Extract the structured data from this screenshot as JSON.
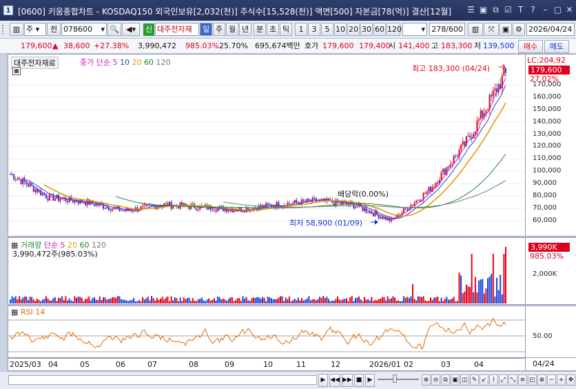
{
  "window": {
    "number": "1",
    "title": "[0600] 키움종합차트 - KOSDAQ150 외국인보유[2,032(천)] 주식수[15,528(천)] 액면[500] 자본금[78(억)] 결산[12월]",
    "buttons": [
      "☰",
      "▣",
      "⧉",
      "☑",
      "T",
      "?",
      "–",
      "▢",
      "✕"
    ]
  },
  "toolbar": {
    "period_type": "주",
    "prev": "전",
    "code": "078600",
    "credit_badge": "신",
    "stock_name": "대주전자재",
    "periods": [
      "일",
      "주",
      "월",
      "년",
      "분",
      "초",
      "틱"
    ],
    "active_period": "일",
    "intervals": [
      "1",
      "3",
      "5",
      "10",
      "20",
      "30",
      "60",
      "120"
    ],
    "count": "278",
    "count_total": "/600",
    "date": "2026/04/24"
  },
  "quote": {
    "price": "179,600",
    "change_arrow": "▲",
    "change": "38,600",
    "change_pct": "+27.38%",
    "volume": "3,990,472",
    "volume_ratio": "985.03%",
    "turnover": "25.70%",
    "trade_value": "695,674백만",
    "hoga_label": "호가",
    "ask": "179,600",
    "bid": "179,400",
    "open_label": "시",
    "open": "141,400",
    "high_label": "고",
    "high": "183,300",
    "low_label": "저",
    "low": "139,500",
    "buy": "매수",
    "sell": "매도"
  },
  "price_pane": {
    "stock_label": "대주전자재료",
    "ma_label": "종가 단순",
    "ma_periods": [
      {
        "value": "5",
        "color": "#c41cc4"
      },
      {
        "value": "10",
        "color": "#1f43d1"
      },
      {
        "value": "20",
        "color": "#e59a00"
      },
      {
        "value": "60",
        "color": "#1b8a2a"
      },
      {
        "value": "120",
        "color": "#777777"
      }
    ],
    "lc_label": "LC:204,92",
    "current_price_tag": "179,600",
    "current_pct": "27.02%",
    "high_annotation": "최고 183,300 (04/24)",
    "low_annotation": "최저 58,900 (01/09)",
    "dividend_annotation": "배당락(0.00%)",
    "y_ticks": [
      "170,000",
      "160,000",
      "150,000",
      "140,000",
      "130,000",
      "120,000",
      "110,000",
      "100,000",
      "90,000",
      "80,000",
      "70,000",
      "60,000"
    ]
  },
  "volume_pane": {
    "label": "거래량",
    "ma_label": "단순",
    "ma_periods": [
      {
        "value": "5",
        "color": "#c41cc4"
      },
      {
        "value": "20",
        "color": "#e59a00"
      },
      {
        "value": "60",
        "color": "#1b8a2a"
      },
      {
        "value": "120",
        "color": "#777777"
      }
    ],
    "value_line": "3,990,472주(985.03%)",
    "current_tag": "3,990K",
    "current_pct": "985.03%",
    "y_ticks": [
      "2,000K"
    ]
  },
  "rsi_pane": {
    "label": "RSI 14",
    "y_ticks": [
      "50.00"
    ]
  },
  "x_axis": {
    "labels": [
      "2025/03",
      "04",
      "05",
      "06",
      "07",
      "08",
      "09",
      "10",
      "11",
      "12",
      "2026/01",
      "02",
      "03",
      "04"
    ],
    "current": "04/24"
  },
  "chart_data": {
    "type": "candlestick",
    "title": "대주전자재료",
    "x_range": [
      "2025/03",
      "2026/04/24"
    ],
    "y_range": [
      55000,
      183300
    ],
    "key_points": [
      {
        "label": "high",
        "date": "04/24",
        "value": 183300
      },
      {
        "label": "low",
        "date": "01/09",
        "value": 58900
      },
      {
        "label": "last",
        "date": "04/24",
        "value": 179600
      }
    ],
    "monthly_close_approx": [
      {
        "month": "2025/03",
        "value": 98000
      },
      {
        "month": "2025/04",
        "value": 79000
      },
      {
        "month": "2025/05",
        "value": 75000
      },
      {
        "month": "2025/06",
        "value": 68000
      },
      {
        "month": "2025/07",
        "value": 73000
      },
      {
        "month": "2025/08",
        "value": 71000
      },
      {
        "month": "2025/09",
        "value": 69000
      },
      {
        "month": "2025/10",
        "value": 73000
      },
      {
        "month": "2025/11",
        "value": 76000
      },
      {
        "month": "2025/12",
        "value": 73000
      },
      {
        "month": "2026/01",
        "value": 60000
      },
      {
        "month": "2026/02",
        "value": 85000
      },
      {
        "month": "2026/03",
        "value": 125000
      },
      {
        "month": "2026/04",
        "value": 179600
      }
    ],
    "rsi_level": 50
  },
  "bottom": {
    "controls": [
      "▶",
      "◀◀",
      "▶▶",
      "■",
      "▶"
    ],
    "tools": [
      "⊕",
      "⊖",
      "⧉",
      "▣",
      "◫",
      "✎",
      "↙",
      "⌇",
      "⤢",
      "⤡",
      "≡",
      "◰",
      "⊗",
      "−",
      "+",
      "✥"
    ]
  }
}
